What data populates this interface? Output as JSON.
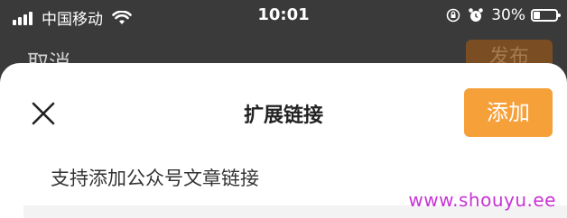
{
  "status_bar": {
    "carrier": "中国移动",
    "time": "10:01",
    "battery_percent": "30%",
    "battery_level": 0.3,
    "icons": [
      "signal-icon",
      "wifi-icon",
      "rotation-lock-icon",
      "alarm-icon",
      "battery-icon"
    ]
  },
  "background": {
    "cancel_label": "取消",
    "publish_label": "发布"
  },
  "sheet": {
    "title": "扩展链接",
    "add_label": "添加",
    "hint": "支持添加公众号文章链接",
    "close_icon": "close-icon"
  },
  "watermark": "www.shouyu.ee",
  "colors": {
    "accent": "#f6a03a",
    "overlay": "#3a3a3a",
    "watermark": "#c832d6"
  }
}
